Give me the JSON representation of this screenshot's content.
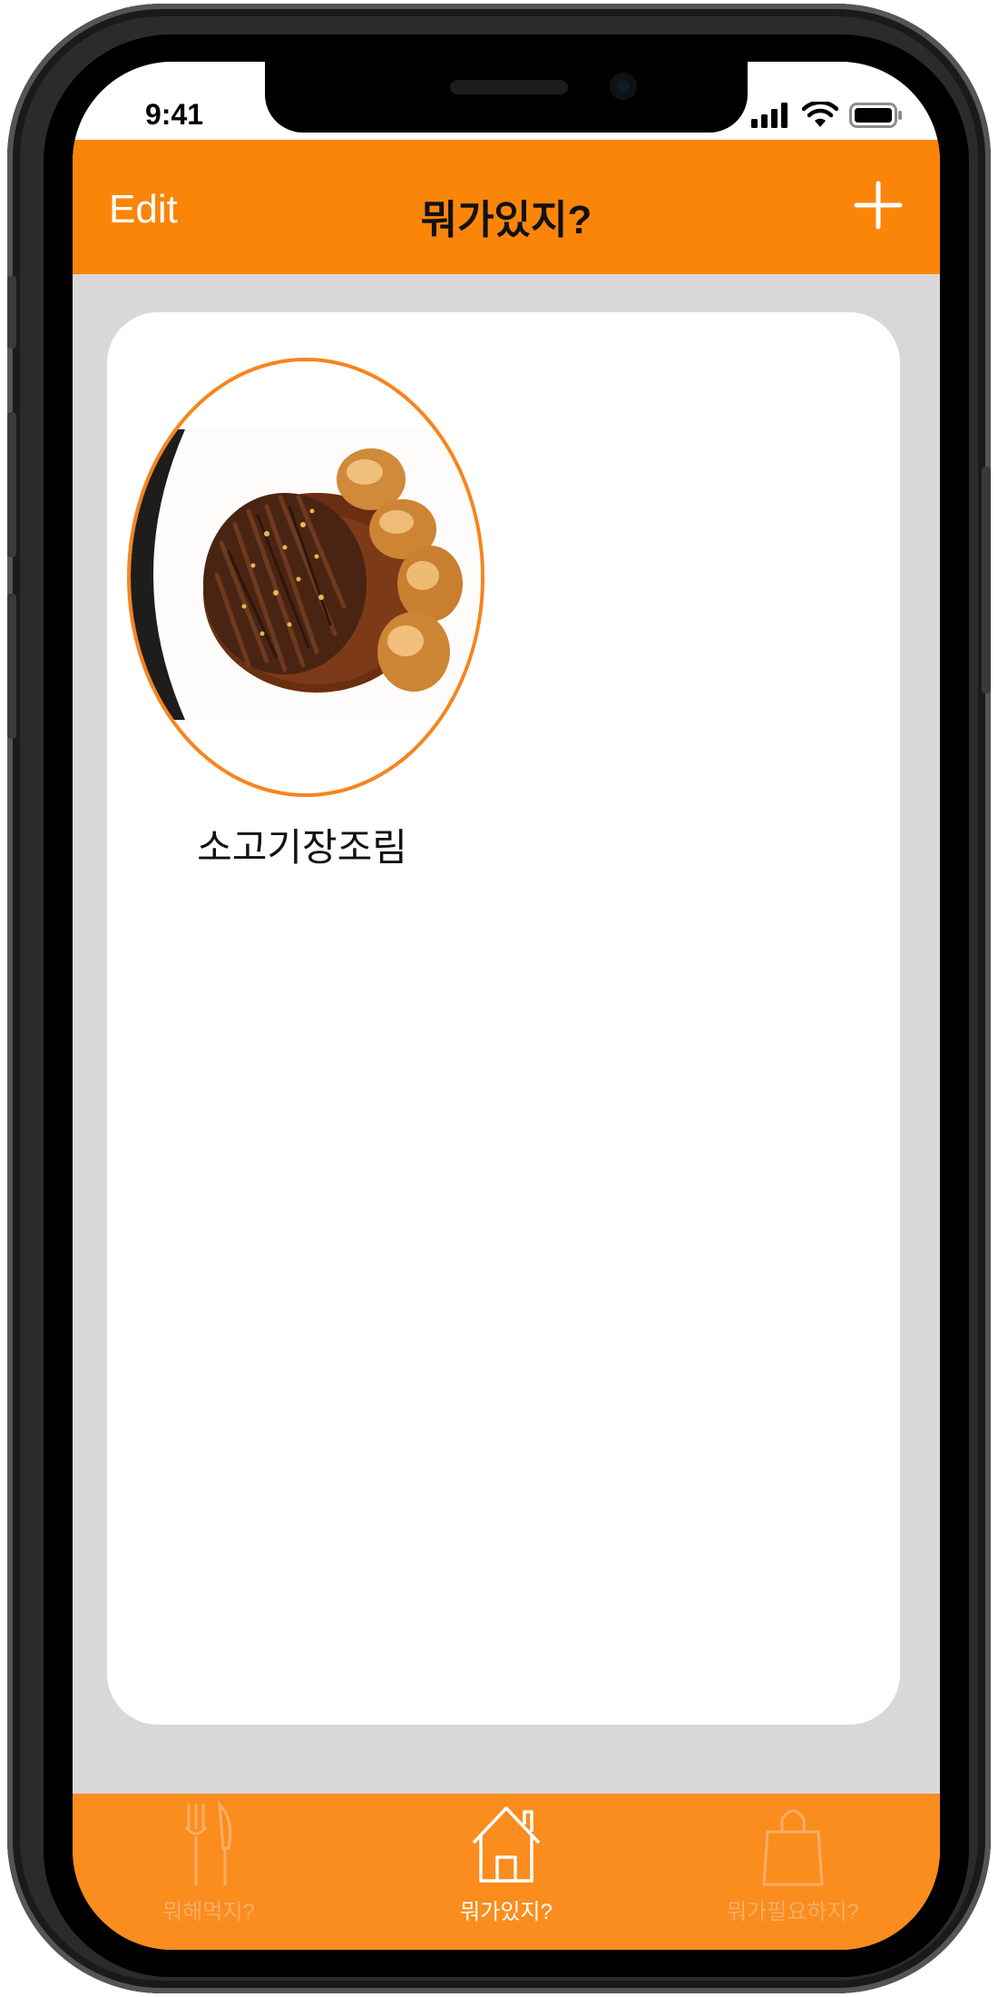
{
  "status_bar": {
    "time": "9:41"
  },
  "nav": {
    "edit_label": "Edit",
    "title": "뭐가있지?",
    "add_icon": "plus-icon"
  },
  "items": [
    {
      "label": "소고기장조림",
      "image": "braised-beef-with-eggs-photo"
    }
  ],
  "tabs": [
    {
      "label": "뭐해먹지?",
      "icon": "fork-knife-icon",
      "active": false
    },
    {
      "label": "뭐가있지?",
      "icon": "house-icon",
      "active": true
    },
    {
      "label": "뭐가필요하지?",
      "icon": "shopping-bag-icon",
      "active": false
    }
  ],
  "colors": {
    "accent": "#fb8509",
    "tab_bar": "#fb8c1e",
    "background": "#d8d8d8",
    "card": "#ffffff",
    "image_border": "#f8841c"
  }
}
